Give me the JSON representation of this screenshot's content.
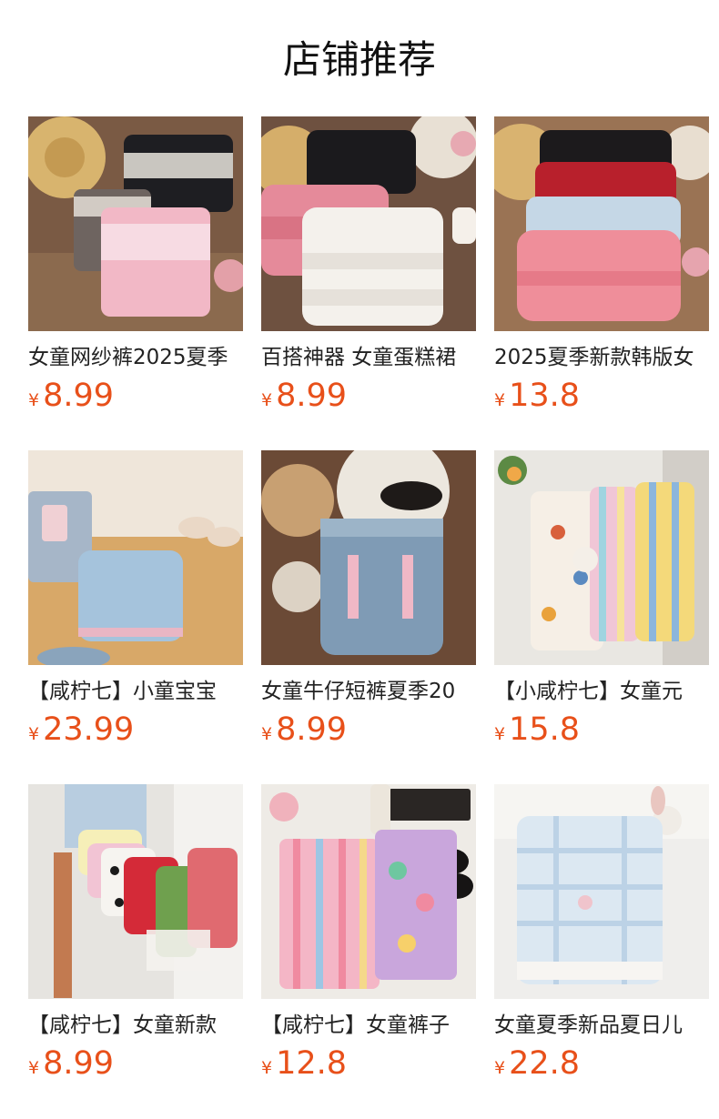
{
  "header": {
    "title": "店铺推荐"
  },
  "products": [
    {
      "name": "女童网纱裤2025夏季",
      "currency": "¥",
      "price": "8.99",
      "image": "lace-shorts-photo"
    },
    {
      "name": "百搭神器 女童蛋糕裙",
      "currency": "¥",
      "price": "8.99",
      "image": "cake-skirt-photo"
    },
    {
      "name": "2025夏季新款韩版女",
      "currency": "¥",
      "price": "13.8",
      "image": "bow-skort-photo"
    },
    {
      "name": "【咸柠七】小童宝宝",
      "currency": "¥",
      "price": "23.99",
      "image": "denim-shorts-photo"
    },
    {
      "name": "女童牛仔短裤夏季20",
      "currency": "¥",
      "price": "8.99",
      "image": "ribbon-denim-shorts-photo"
    },
    {
      "name": "【小咸柠七】女童元",
      "currency": "¥",
      "price": "15.8",
      "image": "printed-pants-photo"
    },
    {
      "name": "【咸柠七】女童新款",
      "currency": "¥",
      "price": "8.99",
      "image": "bloomer-pants-photo"
    },
    {
      "name": "【咸柠七】女童裤子",
      "currency": "¥",
      "price": "12.8",
      "image": "striped-pants-photo"
    },
    {
      "name": "女童夏季新品夏日儿",
      "currency": "¥",
      "price": "22.8",
      "image": "plaid-pants-photo"
    }
  ]
}
